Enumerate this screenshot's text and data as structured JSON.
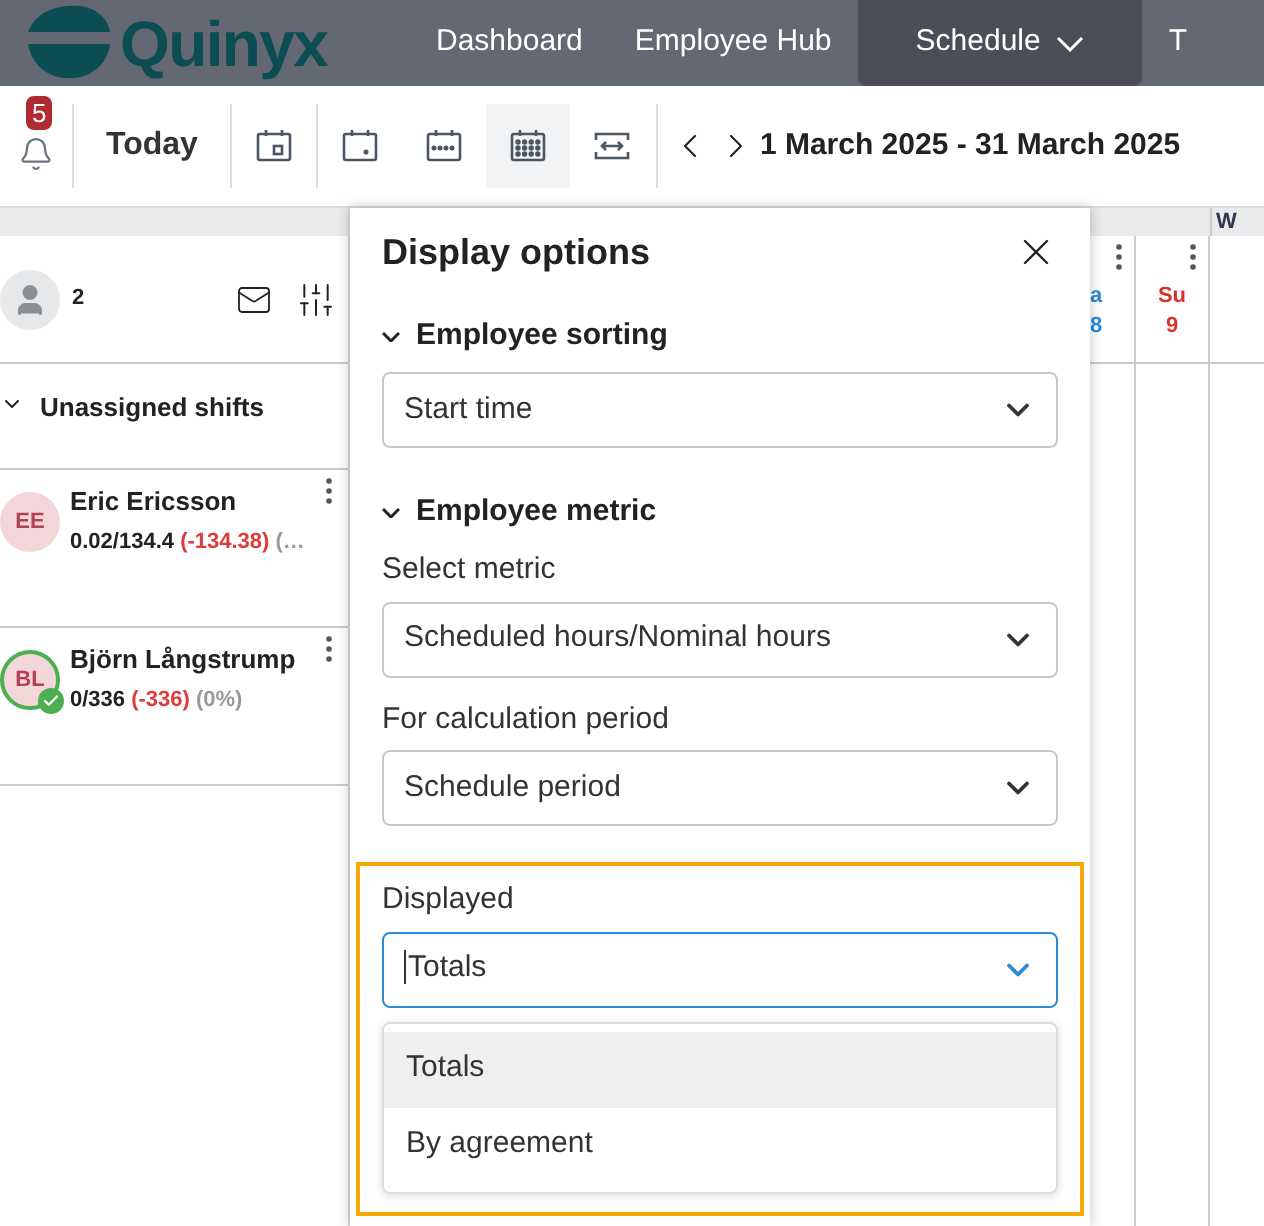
{
  "nav": {
    "logo": "Quinyx",
    "items": [
      {
        "label": "Dashboard",
        "selected": false,
        "dropdown": false
      },
      {
        "label": "Employee Hub",
        "selected": false,
        "dropdown": false
      },
      {
        "label": "Schedule",
        "selected": true,
        "dropdown": true
      },
      {
        "label": "T",
        "selected": false,
        "dropdown": false
      }
    ]
  },
  "toolbar": {
    "notifications": "5",
    "today": "Today",
    "views": [
      {
        "kind": "day",
        "selected": false
      },
      {
        "kind": "week",
        "selected": false
      },
      {
        "kind": "twoweeks",
        "selected": false
      },
      {
        "kind": "month",
        "selected": true
      },
      {
        "kind": "period",
        "selected": false
      }
    ],
    "date_range": "1 March 2025 - 31 March 2025"
  },
  "employees_panel": {
    "count": "2",
    "group": "Unassigned shifts",
    "employees": [
      {
        "initials": "EE",
        "name": "Eric Ericsson",
        "hours": "0.02/134.4",
        "difference": "(-134.38)",
        "percent": "(…",
        "verified": false
      },
      {
        "initials": "BL",
        "name": "Björn Långstrump",
        "hours": "0/336",
        "difference": "(-336)",
        "percent": "(0%)",
        "verified": true
      }
    ]
  },
  "calendar": {
    "week_label": "W",
    "days": [
      {
        "weekday": "a",
        "day": "8",
        "color": "#2a8bd6"
      },
      {
        "weekday": "Su",
        "day": "9",
        "color": "#d9342b"
      }
    ]
  },
  "dialog": {
    "title": "Display options",
    "sections": [
      {
        "heading": "Employee sorting",
        "expanded": true,
        "fields": [
          {
            "value": "Start time"
          }
        ]
      },
      {
        "heading": "Employee metric",
        "expanded": true,
        "fields": [
          {
            "label": "Select metric",
            "value": "Scheduled hours/Nominal hours"
          },
          {
            "label": "For calculation period",
            "value": "Schedule period"
          }
        ]
      }
    ],
    "displayed": {
      "label": "Displayed",
      "value": "Totals",
      "options": [
        {
          "label": "Totals",
          "selected": true
        },
        {
          "label": "By agreement",
          "selected": false
        }
      ]
    }
  }
}
